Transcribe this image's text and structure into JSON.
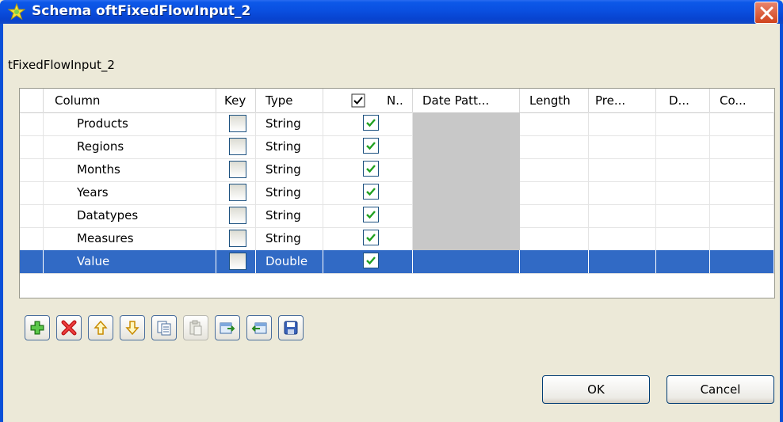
{
  "window": {
    "title": "Schema oftFixedFlowInput_2",
    "subtitle": "tFixedFlowInput_2"
  },
  "table": {
    "headers": {
      "column": "Column",
      "key": "Key",
      "type": "Type",
      "nullable": "N..",
      "date_pattern": "Date Patt...",
      "length": "Length",
      "precision": "Pre...",
      "default": "D...",
      "comment": "Co..."
    },
    "rows": [
      {
        "column": "Products",
        "key": false,
        "type": "String",
        "nullable": true
      },
      {
        "column": "Regions",
        "key": false,
        "type": "String",
        "nullable": true
      },
      {
        "column": "Months",
        "key": false,
        "type": "String",
        "nullable": true
      },
      {
        "column": "Years",
        "key": false,
        "type": "String",
        "nullable": true
      },
      {
        "column": "Datatypes",
        "key": false,
        "type": "String",
        "nullable": true
      },
      {
        "column": "Measures",
        "key": false,
        "type": "String",
        "nullable": true
      },
      {
        "column": "Value",
        "key": false,
        "type": "Double",
        "nullable": true,
        "selected": true
      }
    ]
  },
  "toolbar": {
    "icons": [
      "add-icon",
      "remove-icon",
      "move-up-icon",
      "move-down-icon",
      "copy-icon",
      "paste-icon",
      "import-icon",
      "export-icon",
      "save-icon"
    ]
  },
  "buttons": {
    "ok": "OK",
    "cancel": "Cancel"
  },
  "colors": {
    "title_bar": "#0a4fe0",
    "selection": "#316ac5",
    "close_button": "#d0431c"
  }
}
